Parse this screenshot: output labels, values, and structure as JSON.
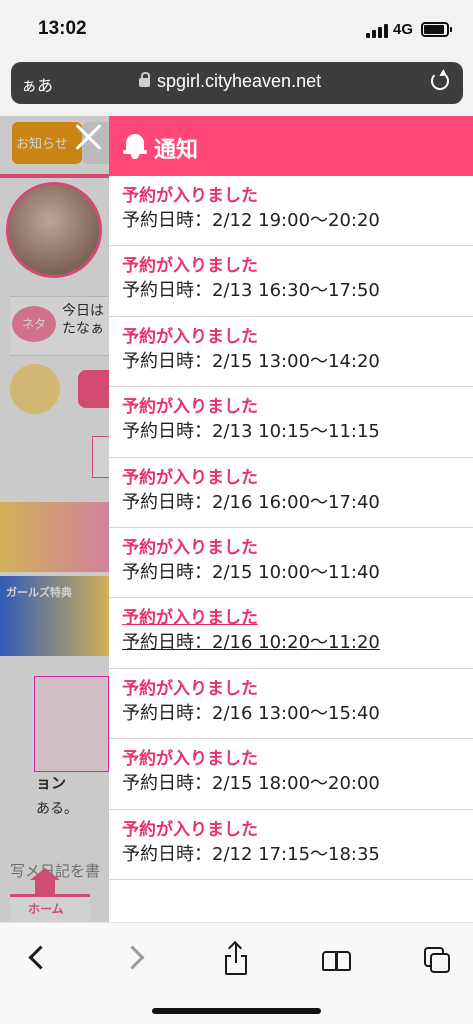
{
  "status_bar": {
    "time": "13:02",
    "network": "4G"
  },
  "url_bar": {
    "aa_label": "ぁあ",
    "host": "spgirl.cityheaven.net"
  },
  "background_page": {
    "notice_tab": "お知らせ",
    "neta_badge": "ネタ",
    "neta_text_1": "今日は",
    "neta_text_2": "たなぁ",
    "banner_text": "ガールズ特典",
    "promo_text_1": "ョン",
    "promo_text_2": "ある。",
    "footer_hint": "写メ日記を書",
    "home_label": "ホーム"
  },
  "notifications_panel": {
    "title": "通知",
    "items": [
      {
        "title": "予約が入りました",
        "detail": "予約日時：2/12 19:00〜20:20"
      },
      {
        "title": "予約が入りました",
        "detail": "予約日時：2/13 16:30〜17:50"
      },
      {
        "title": "予約が入りました",
        "detail": "予約日時：2/15 13:00〜14:20"
      },
      {
        "title": "予約が入りました",
        "detail": "予約日時：2/13 10:15〜11:15"
      },
      {
        "title": "予約が入りました",
        "detail": "予約日時：2/16 16:00〜17:40"
      },
      {
        "title": "予約が入りました",
        "detail": "予約日時：2/15 10:00〜11:40"
      },
      {
        "title": "予約が入りました",
        "detail": "予約日時：2/16 10:20〜11:20"
      },
      {
        "title": "予約が入りました",
        "detail": "予約日時：2/16 13:00〜15:40"
      },
      {
        "title": "予約が入りました",
        "detail": "予約日時：2/15 18:00〜20:00"
      },
      {
        "title": "予約が入りました",
        "detail": "予約日時：2/12 17:15〜18:35"
      }
    ]
  },
  "colors": {
    "accent": "#ff4778",
    "title_text": "#e8336a"
  },
  "icons": [
    "close-icon",
    "bell-icon",
    "lock-icon",
    "reload-icon",
    "back-icon",
    "forward-icon",
    "share-icon",
    "bookmarks-icon",
    "tabs-icon"
  ]
}
